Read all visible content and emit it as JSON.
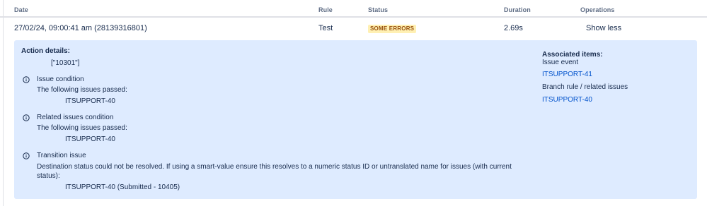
{
  "table": {
    "headers": {
      "date": "Date",
      "rule": "Rule",
      "status": "Status",
      "duration": "Duration",
      "operations": "Operations"
    },
    "row": {
      "date": "27/02/24, 09:00:41 am (28139316801)",
      "rule": "Test",
      "status": "SOME ERRORS",
      "duration": "2.69s",
      "operation": "Show less"
    }
  },
  "details": {
    "action_details_label": "Action details:",
    "action_value": "[\"10301\"]",
    "sections": [
      {
        "title": "Issue condition",
        "description": "The following issues passed:",
        "item": "ITSUPPORT-40"
      },
      {
        "title": "Related issues condition",
        "description": "The following issues passed:",
        "item": "ITSUPPORT-40"
      },
      {
        "title": "Transition issue",
        "description": "Destination status could not be resolved. If using a smart-value ensure this resolves to a numeric status ID or untranslated name for issues (with current status):",
        "item": "ITSUPPORT-40 (Submitted - 10405)"
      }
    ],
    "associated": {
      "label": "Associated items:",
      "issue_event_label": "Issue event",
      "issue_event_link": "ITSUPPORT-41",
      "branch_label": "Branch rule / related issues",
      "branch_link": "ITSUPPORT-40"
    }
  },
  "colors": {
    "panel_bg": "#deebff",
    "link": "#0052cc",
    "lozenge_bg": "#fff0b3",
    "lozenge_text": "#974f0c"
  }
}
